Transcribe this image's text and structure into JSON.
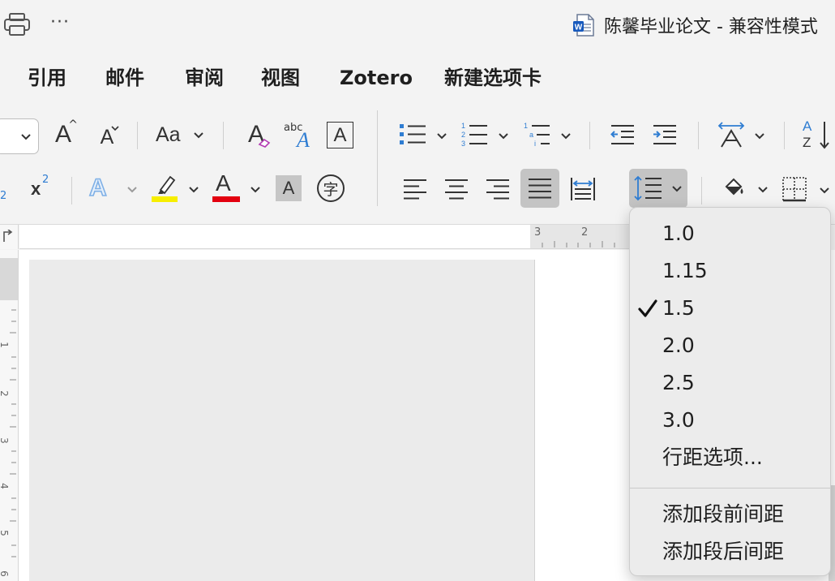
{
  "titlebar": {
    "document_title": "陈馨毕业论文 - 兼容性模式",
    "more_label": "···"
  },
  "tabs": [
    "引用",
    "邮件",
    "审阅",
    "视图",
    "Zotero",
    "新建选项卡"
  ],
  "ribbon": {
    "grow_font_label": "A",
    "shrink_font_label": "A",
    "change_case_label": "Aa",
    "clear_format_label": "A",
    "spelling_abc_label": "abc",
    "spelling_a_label": "A",
    "char_border_label": "A",
    "superscript_label": "x",
    "superscript_exp": "2",
    "subscript_exp": "2",
    "text_effect_label": "A",
    "font_color_label": "A",
    "char_shading_label": "A",
    "enclose_char_label": "字",
    "sort_a": "A",
    "sort_z": "Z",
    "colors": {
      "highlight": "#f7ee00",
      "font_color": "#e3000f",
      "accent": "#2f7dd2"
    }
  },
  "line_spacing_menu": {
    "items": [
      {
        "label": "1.0",
        "checked": false
      },
      {
        "label": "1.15",
        "checked": false
      },
      {
        "label": "1.5",
        "checked": true
      },
      {
        "label": "2.0",
        "checked": false
      },
      {
        "label": "2.5",
        "checked": false
      },
      {
        "label": "3.0",
        "checked": false
      },
      {
        "label": "行距选项...",
        "checked": false
      }
    ],
    "extra_items": [
      {
        "label": "添加段前间距"
      },
      {
        "label": "添加段后间距"
      }
    ],
    "check_glyph": "✓"
  },
  "ruler": {
    "top_numbers": [
      "3",
      "2"
    ],
    "side_numbers": [
      "1",
      "2",
      "3",
      "4",
      "5",
      "6"
    ]
  }
}
